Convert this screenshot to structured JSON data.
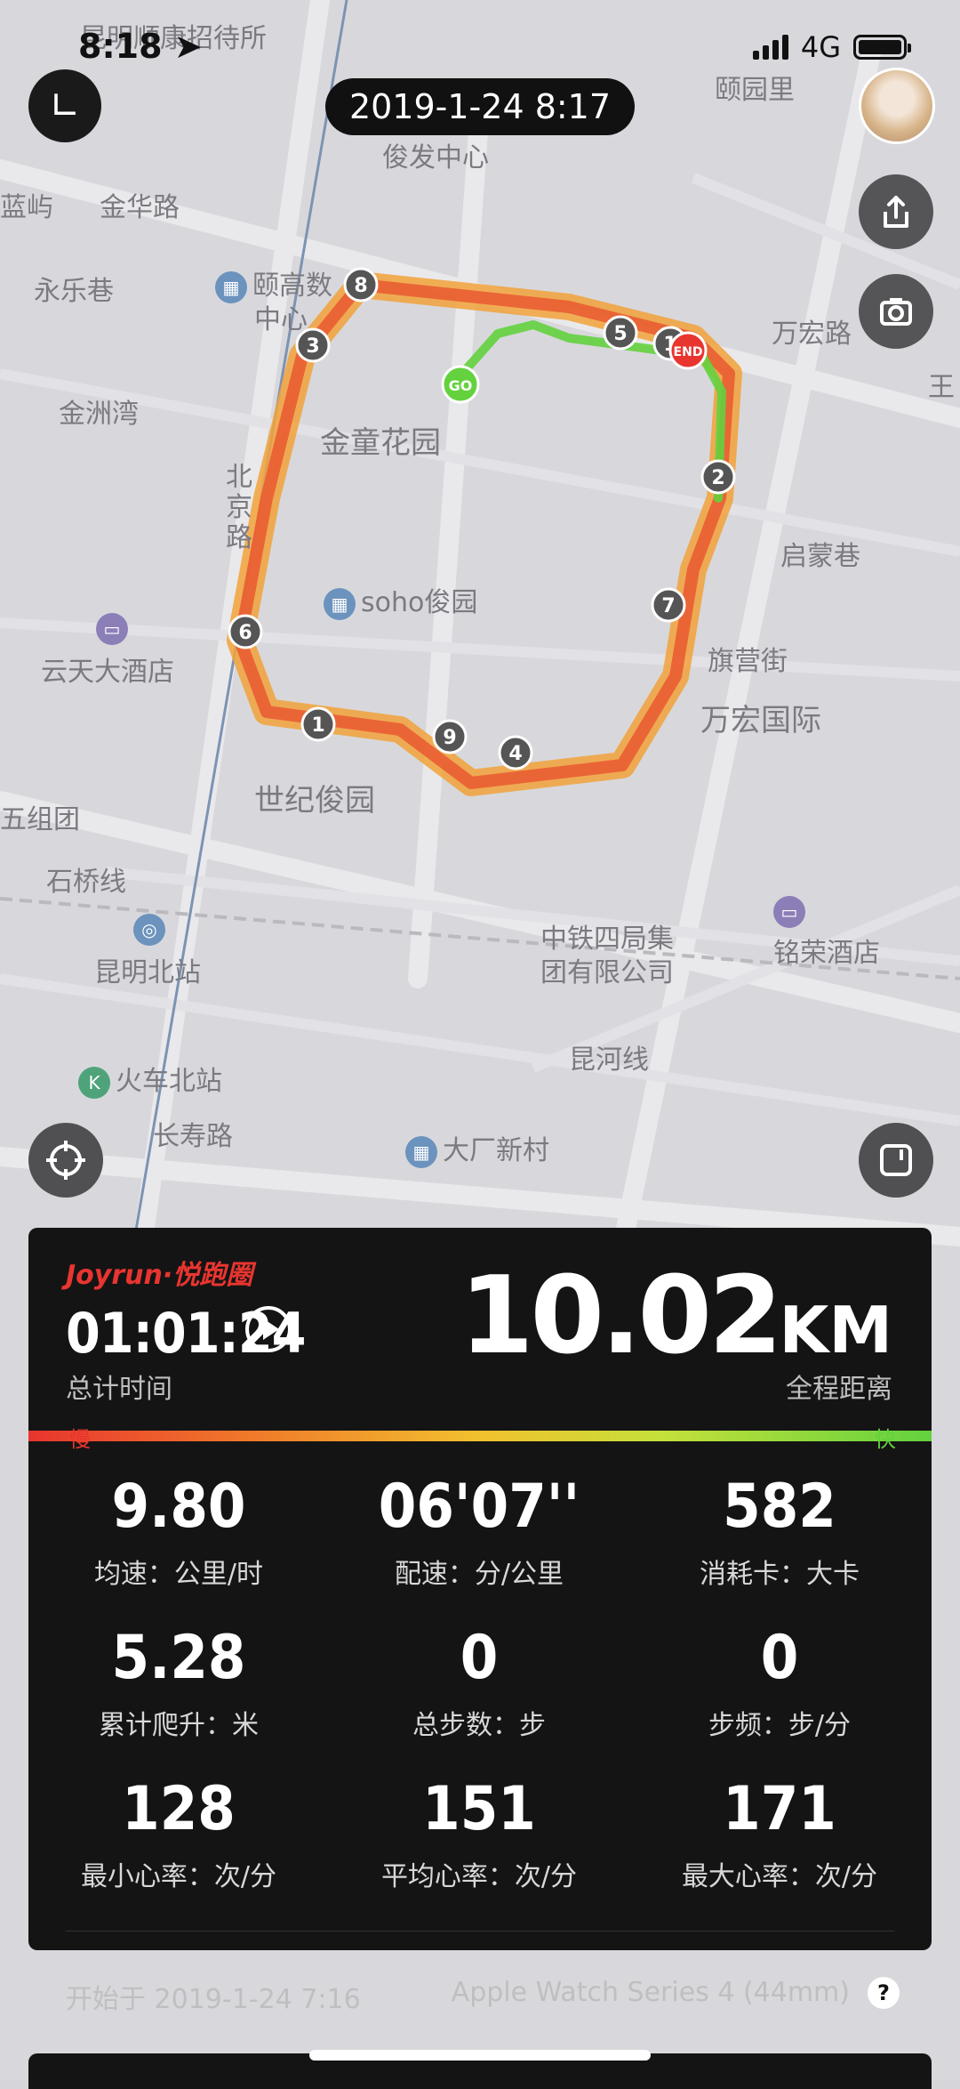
{
  "status_bar": {
    "time": "8:18",
    "network": "4G"
  },
  "header": {
    "date_time": "2019-1-24 8:17"
  },
  "map": {
    "labels": {
      "l1": "昆明顺康招待所",
      "l2": "颐园里",
      "l3": "俊发中心",
      "l4": "金华路",
      "l5": "蓝屿",
      "l6": "永乐巷",
      "l7": "颐高数",
      "l8": "中心",
      "l9": "金洲湾",
      "l10": "金童花园",
      "l11": "北京路",
      "l12": "soho俊园",
      "l13": "云天大酒店",
      "l14": "世纪俊园",
      "l15": "五组团",
      "l16": "启蒙巷",
      "l17": "旗营街",
      "l18": "万宏国际",
      "l19": "中铁四局集",
      "l20": "团有限公司",
      "l21": "铭荣酒店",
      "l22": "昆明北站",
      "l23": "石桥线",
      "l24": "火车北站",
      "l25": "长寿路",
      "l26": "大厂新村",
      "l27": "昆河线",
      "l28": "万宏路",
      "l29": "王"
    },
    "markers": [
      "1",
      "2",
      "3",
      "4",
      "5",
      "6",
      "7",
      "8",
      "9",
      "1"
    ],
    "start_label": "GO",
    "end_label": "END",
    "route_colors": {
      "slow": "#e8352f",
      "mid": "#f2a23a",
      "fast": "#63d23e"
    }
  },
  "panel": {
    "brand": "Joyrun·悦跑圈",
    "total_time": "01:01:24",
    "total_time_label": "总计时间",
    "distance_value": "10.02",
    "distance_unit": "KM",
    "distance_label": "全程距离",
    "bar_slow": "慢",
    "bar_fast": "快",
    "stats": [
      {
        "value": "9.80",
        "label": "均速：公里/时"
      },
      {
        "value": "06'07''",
        "label": "配速：分/公里"
      },
      {
        "value": "582",
        "label": "消耗卡：大卡"
      },
      {
        "value": "5.28",
        "label": "累计爬升：米"
      },
      {
        "value": "0",
        "label": "总步数：步"
      },
      {
        "value": "0",
        "label": "步频：步/分"
      },
      {
        "value": "128",
        "label": "最小心率：次/分"
      },
      {
        "value": "151",
        "label": "平均心率：次/分"
      },
      {
        "value": "171",
        "label": "最大心率：次/分"
      }
    ],
    "start_text": "开始于 2019-1-24 7:16",
    "device": "Apple Watch Series 4 (44mm)",
    "help": "?"
  }
}
